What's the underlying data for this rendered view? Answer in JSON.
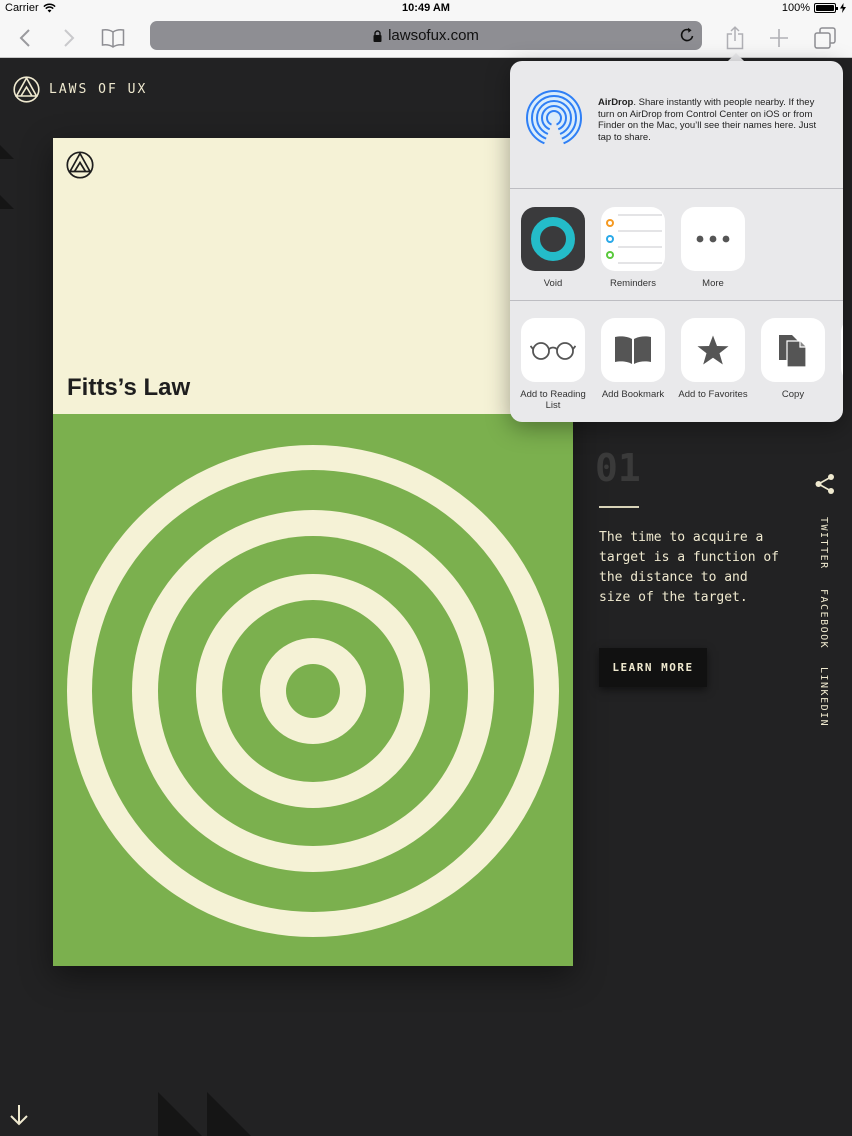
{
  "status_bar": {
    "carrier": "Carrier",
    "time": "10:49 AM",
    "battery": "100%"
  },
  "toolbar": {
    "url": "lawsofux.com"
  },
  "site": {
    "name": "LAWS OF UX"
  },
  "card": {
    "title": "Fitts’s Law"
  },
  "law": {
    "number": "01",
    "description": "The time to acquire a target is a function of the distance to and size of the target.",
    "button_label": "LEARN MORE"
  },
  "social": {
    "links": [
      "TWITTER",
      "FACEBOOK",
      "LINKEDIN"
    ]
  },
  "share_sheet": {
    "airdrop_title": "AirDrop",
    "airdrop_text": ". Share instantly with people nearby. If they turn on AirDrop from Control Center on iOS or from Finder on the Mac, you’ll see their names here. Just tap to share.",
    "apps": [
      {
        "label": "Void",
        "icon": "void-app-icon"
      },
      {
        "label": "Reminders",
        "icon": "reminders-app-icon"
      },
      {
        "label": "More",
        "icon": "more-icon"
      }
    ],
    "actions": [
      {
        "label": "Add to Reading List",
        "icon": "glasses-icon"
      },
      {
        "label": "Add Bookmark",
        "icon": "book-icon"
      },
      {
        "label": "Add to Favorites",
        "icon": "star-icon"
      },
      {
        "label": "Copy",
        "icon": "copy-icon"
      }
    ]
  },
  "colors": {
    "page_background": "#222223",
    "card_cream": "#f5f2d6",
    "card_green": "#7bb04e",
    "text_cream": "#efe9cf",
    "ios_blue": "#2f7ff5"
  }
}
